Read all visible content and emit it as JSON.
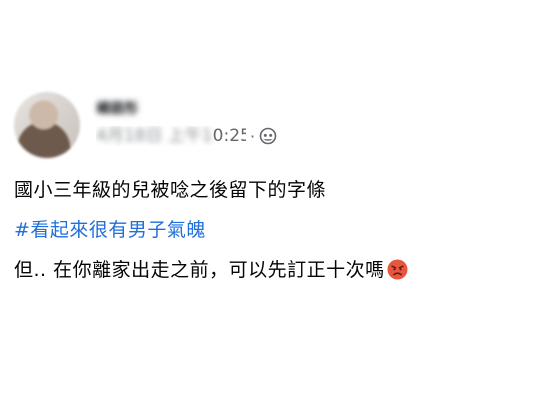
{
  "post": {
    "author": {
      "name": "楊語彤"
    },
    "timestamp": "4月18日 上午10:25",
    "timestamp_visible": "0:25",
    "separator": "·",
    "audience_icon": "public-globe-icon",
    "lines": [
      "國小三年級的兒被唸之後留下的字條",
      "#看起來很有男子氣魄",
      "但.. 在你離家出走之前，可以先訂正十次嗎"
    ],
    "emoji": "angry-face-icon",
    "colors": {
      "hashtag": "#216fdb",
      "meta": "#65676b",
      "emoji": "#e8563f"
    }
  }
}
